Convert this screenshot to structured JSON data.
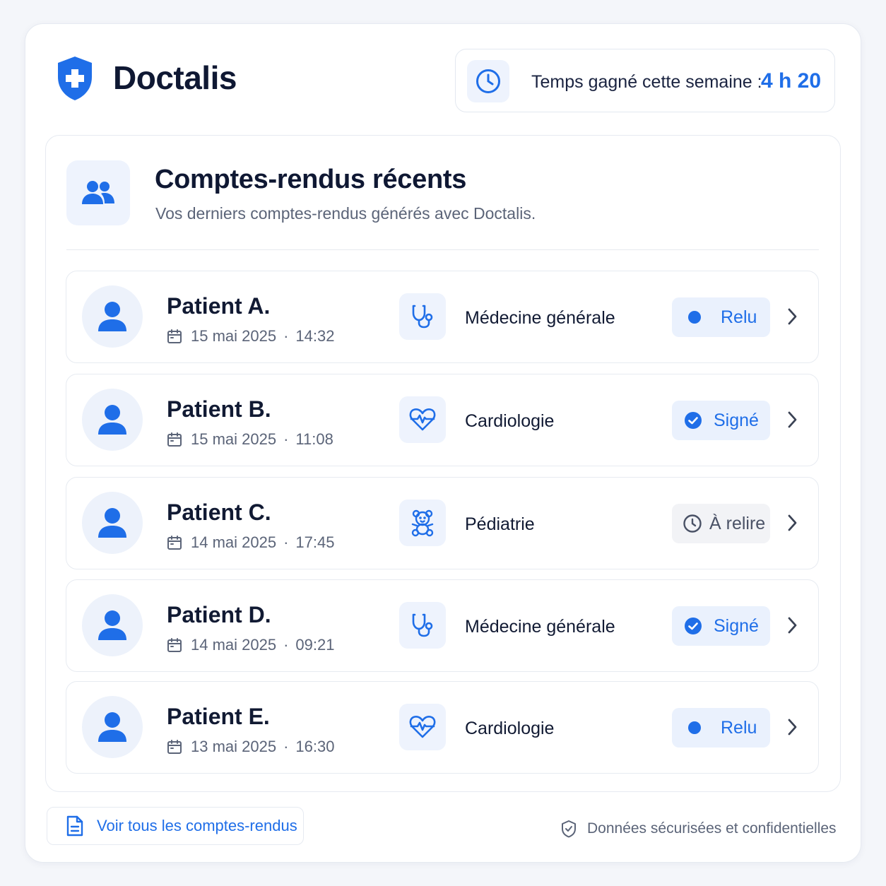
{
  "app": {
    "brand": "Doctalis",
    "time_saved_label": "Temps gagné cette semaine :",
    "time_saved_value": "4 h 20"
  },
  "section": {
    "title": "Comptes-rendus récents",
    "subtitle": "Vos derniers comptes-rendus générés avec Doctalis."
  },
  "reports": [
    {
      "patient": "Patient A.",
      "date": "15 mai 2025",
      "time": "14:32",
      "specialty": "Médecine générale",
      "specialty_icon": "stethoscope-icon",
      "status": "Relu",
      "status_type": "read"
    },
    {
      "patient": "Patient B.",
      "date": "15 mai 2025",
      "time": "11:08",
      "specialty": "Cardiologie",
      "specialty_icon": "heart-pulse-icon",
      "status": "Signé",
      "status_type": "signed"
    },
    {
      "patient": "Patient C.",
      "date": "14 mai 2025",
      "time": "17:45",
      "specialty": "Pédiatrie",
      "specialty_icon": "teddy-bear-icon",
      "status": "À relire",
      "status_type": "pending"
    },
    {
      "patient": "Patient D.",
      "date": "14 mai 2025",
      "time": "09:21",
      "specialty": "Médecine générale",
      "specialty_icon": "stethoscope-icon",
      "status": "Signé",
      "status_type": "signed"
    },
    {
      "patient": "Patient E.",
      "date": "13 mai 2025",
      "time": "16:30",
      "specialty": "Cardiologie",
      "specialty_icon": "heart-pulse-icon",
      "status": "Relu",
      "status_type": "read"
    }
  ],
  "footer": {
    "view_all": "Voir tous les comptes-rendus",
    "security_note": "Données sécurisées et confidentielles"
  },
  "colors": {
    "accent": "#1f6ee8",
    "accent_light": "#eaf1fd",
    "text_dark": "#111a33",
    "text_muted": "#5b6478"
  }
}
